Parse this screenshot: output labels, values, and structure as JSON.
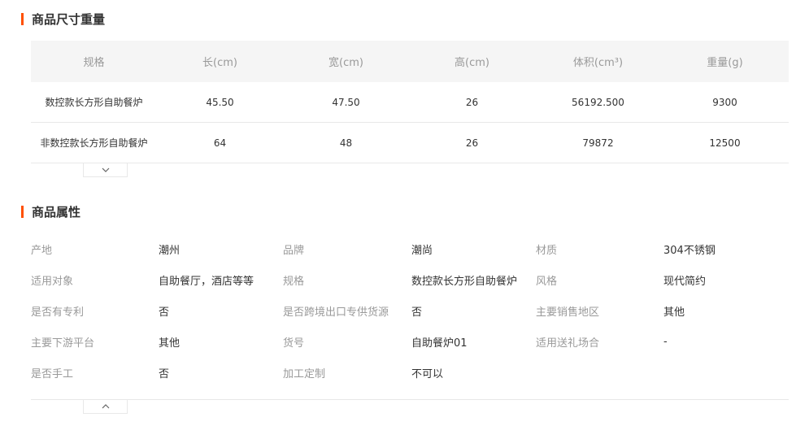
{
  "size_section": {
    "title": "商品尺寸重量",
    "headers": [
      "规格",
      "长(cm)",
      "宽(cm)",
      "高(cm)",
      "体积(cm³)",
      "重量(g)"
    ],
    "rows": [
      [
        "数控款长方形自助餐炉",
        "45.50",
        "47.50",
        "26",
        "56192.500",
        "9300"
      ],
      [
        "非数控款长方形自助餐炉",
        "64",
        "48",
        "26",
        "79872",
        "12500"
      ]
    ]
  },
  "attr_section": {
    "title": "商品属性",
    "rows": [
      [
        [
          "产地",
          "潮州"
        ],
        [
          "品牌",
          "潮尚"
        ],
        [
          "材质",
          "304不锈钢"
        ]
      ],
      [
        [
          "适用对象",
          "自助餐厅，酒店等等"
        ],
        [
          "规格",
          "数控款长方形自助餐炉"
        ],
        [
          "风格",
          "现代简约"
        ]
      ],
      [
        [
          "是否有专利",
          "否"
        ],
        [
          "是否跨境出口专供货源",
          "否"
        ],
        [
          "主要销售地区",
          "其他"
        ]
      ],
      [
        [
          "主要下游平台",
          "其他"
        ],
        [
          "货号",
          "自助餐炉01"
        ],
        [
          "适用送礼场合",
          "-"
        ]
      ],
      [
        [
          "是否手工",
          "否"
        ],
        [
          "加工定制",
          "不可以"
        ]
      ]
    ]
  },
  "colors": {
    "accent": "#ff5000",
    "header_bg": "#f5f5f5",
    "label": "#999999",
    "text": "#333333",
    "border": "#e8e8e8"
  },
  "icons": {
    "size_toggle": "chevron-down-icon",
    "attr_toggle": "chevron-up-icon"
  }
}
